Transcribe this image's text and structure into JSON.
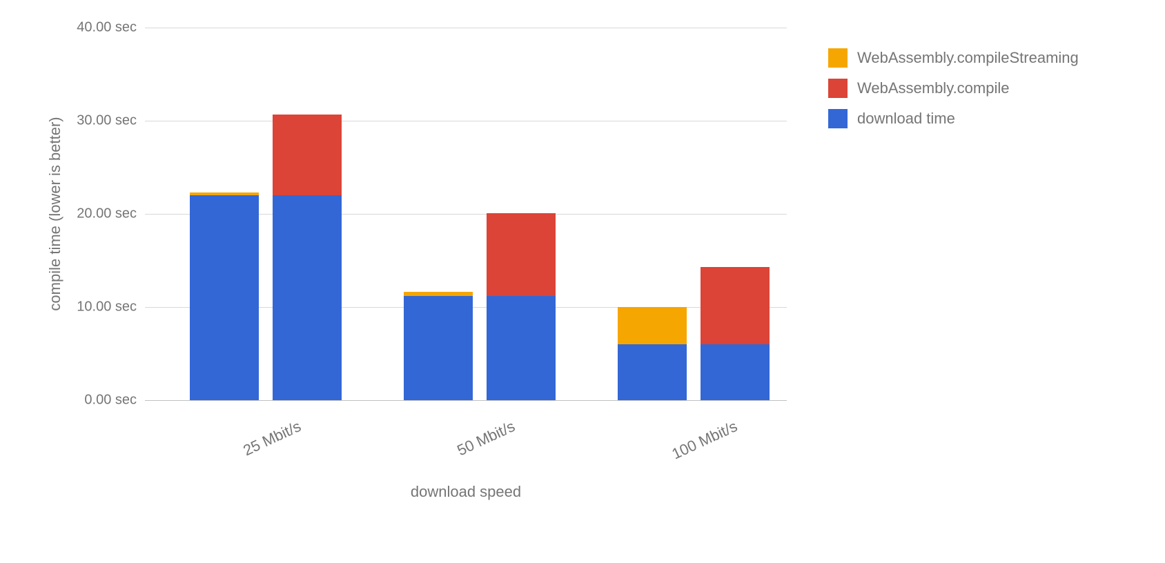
{
  "chart_data": {
    "type": "bar",
    "stacked": true,
    "grouped": true,
    "ylabel": "compile time (lower is better)",
    "xlabel": "download speed",
    "ylim": [
      0,
      40
    ],
    "y_ticks": [
      0,
      10,
      20,
      30,
      40
    ],
    "y_tick_labels": [
      "0.00 sec",
      "10.00 sec",
      "20.00 sec",
      "30.00 sec",
      "40.00 sec"
    ],
    "categories": [
      "25 Mbit/s",
      "50 Mbit/s",
      "100 Mbit/s"
    ],
    "subgroups": [
      "streaming",
      "non_streaming"
    ],
    "series": [
      {
        "name": "download time",
        "key": "download",
        "color": "#3367d6"
      },
      {
        "name": "WebAssembly.compile",
        "key": "compile",
        "color": "#db4437"
      },
      {
        "name": "WebAssembly.compileStreaming",
        "key": "stream",
        "color": "#f6a600"
      }
    ],
    "legend_order": [
      "stream",
      "compile",
      "download"
    ],
    "data": {
      "25 Mbit/s": {
        "streaming": {
          "download": 22.0,
          "compile": 0.0,
          "stream": 0.3
        },
        "non_streaming": {
          "download": 22.0,
          "compile": 8.7,
          "stream": 0.0
        }
      },
      "50 Mbit/s": {
        "streaming": {
          "download": 11.2,
          "compile": 0.0,
          "stream": 0.4
        },
        "non_streaming": {
          "download": 11.2,
          "compile": 8.9,
          "stream": 0.0
        }
      },
      "100 Mbit/s": {
        "streaming": {
          "download": 6.0,
          "compile": 0.0,
          "stream": 4.0
        },
        "non_streaming": {
          "download": 6.0,
          "compile": 8.3,
          "stream": 0.0
        }
      }
    }
  }
}
